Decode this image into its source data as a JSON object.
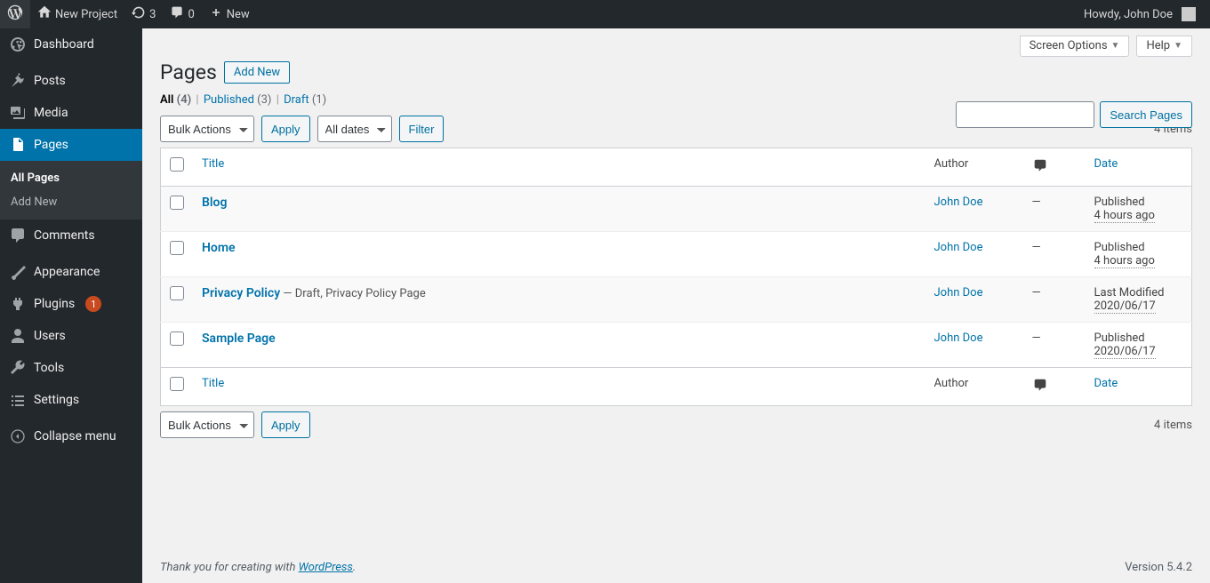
{
  "adminbar": {
    "site_name": "New Project",
    "updates_count": "3",
    "comments_count": "0",
    "new_label": "New",
    "howdy": "Howdy, John Doe"
  },
  "menu": {
    "dashboard": "Dashboard",
    "posts": "Posts",
    "media": "Media",
    "pages": "Pages",
    "all_pages": "All Pages",
    "add_new": "Add New",
    "comments": "Comments",
    "appearance": "Appearance",
    "plugins": "Plugins",
    "plugin_updates": "1",
    "users": "Users",
    "tools": "Tools",
    "settings": "Settings",
    "collapse": "Collapse menu"
  },
  "top": {
    "screen_options": "Screen Options",
    "help": "Help"
  },
  "heading": "Pages",
  "add_new_btn": "Add New",
  "statuses": {
    "all": "All",
    "all_count": "(4)",
    "published": "Published",
    "published_count": "(3)",
    "draft": "Draft",
    "draft_count": "(1)"
  },
  "search_btn": "Search Pages",
  "bulk_actions": "Bulk Actions",
  "apply": "Apply",
  "all_dates": "All dates",
  "filter": "Filter",
  "items_count": "4 items",
  "columns": {
    "title": "Title",
    "author": "Author",
    "date": "Date"
  },
  "rows": [
    {
      "title": "Blog",
      "state": "",
      "author": "John Doe",
      "comments": "—",
      "date_status": "Published",
      "date_value": "4 hours ago"
    },
    {
      "title": "Home",
      "state": "",
      "author": "John Doe",
      "comments": "—",
      "date_status": "Published",
      "date_value": "4 hours ago"
    },
    {
      "title": "Privacy Policy",
      "state": " — Draft, Privacy Policy Page",
      "author": "John Doe",
      "comments": "—",
      "date_status": "Last Modified",
      "date_value": "2020/06/17"
    },
    {
      "title": "Sample Page",
      "state": "",
      "author": "John Doe",
      "comments": "—",
      "date_status": "Published",
      "date_value": "2020/06/17"
    }
  ],
  "footer": {
    "thanks_prefix": "Thank you for creating with ",
    "wordpress": "WordPress",
    "period": ".",
    "version": "Version 5.4.2"
  }
}
